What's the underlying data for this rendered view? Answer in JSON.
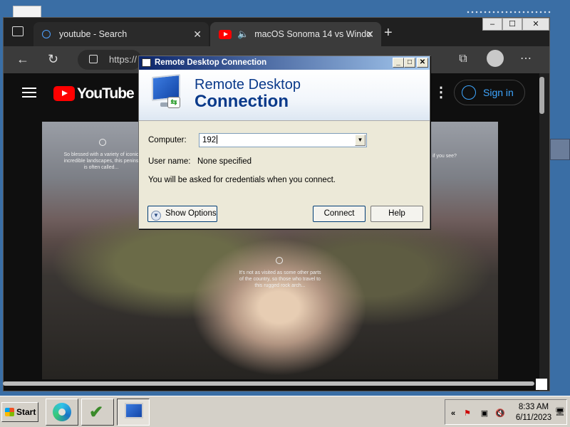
{
  "browser": {
    "tabs": [
      {
        "label": "youtube - Search",
        "close": "✕"
      },
      {
        "label": "macOS Sonoma 14 vs Windo",
        "close": "✕"
      }
    ],
    "new_tab": "+",
    "window_controls": {
      "minimize": "‒",
      "maximize": "☐",
      "close": "✕"
    },
    "address": {
      "url": "https://"
    },
    "nav": {
      "back": "←",
      "refresh": "↻"
    },
    "more": "⋯"
  },
  "youtube": {
    "brand": "YouTube",
    "sign_in": "Sign in",
    "more": "⋮",
    "video_captions": [
      "So blessed with a variety of iconic\nincredible landscapes, this penins\nis often called...",
      "It's not as visited as some other parts\nof the country, so those who travel to\nthis rugged rock arch...",
      "if you see?"
    ]
  },
  "rdp": {
    "title": "Remote Desktop Connection",
    "banner_line1": "Remote Desktop",
    "banner_line2": "Connection",
    "computer_label": "Computer:",
    "computer_value": "192",
    "username_label": "User name:",
    "username_value": "None specified",
    "info_text": "You will be asked for credentials when you connect.",
    "show_options": "Show Options",
    "connect": "Connect",
    "help": "Help",
    "controls": {
      "minimize": "_",
      "maximize": "□",
      "close": "✕"
    }
  },
  "taskbar": {
    "start": "Start",
    "tray_expand": "«",
    "time": "8:33 AM",
    "date": "6/11/2023"
  }
}
